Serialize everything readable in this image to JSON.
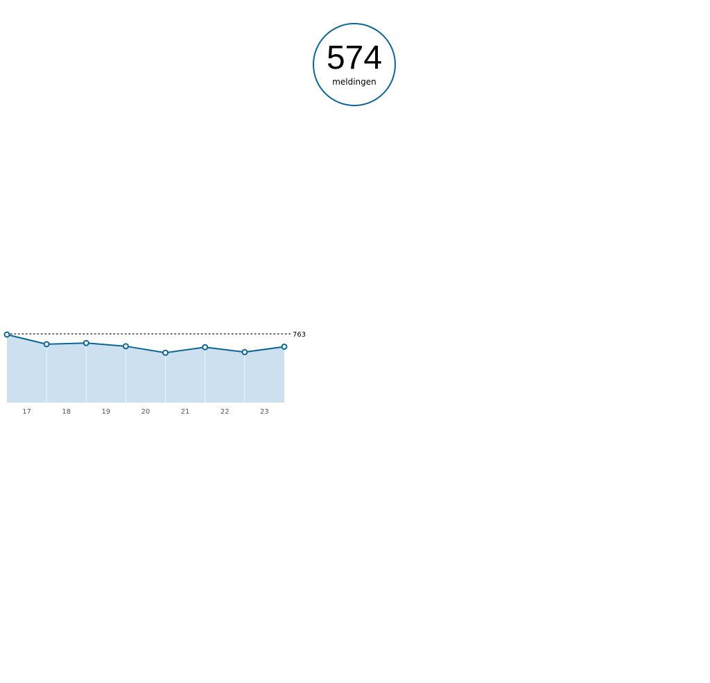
{
  "summary": {
    "value": "574",
    "label": "meldingen"
  },
  "colors": {
    "accent": "#0a6496",
    "area_fill": "#cde0f0",
    "point_fill": "#ffffff",
    "axis_text": "#555555",
    "max_text": "#000000"
  },
  "chart_data": {
    "type": "area",
    "x": [
      "17",
      "18",
      "19",
      "20",
      "21",
      "22",
      "23"
    ],
    "values": [
      763,
      655,
      668,
      632,
      559,
      621,
      566,
      627
    ],
    "ylim": [
      0,
      763
    ],
    "max_line": {
      "value": 763,
      "label": "763"
    },
    "grid": "vertical",
    "legend": "none"
  }
}
